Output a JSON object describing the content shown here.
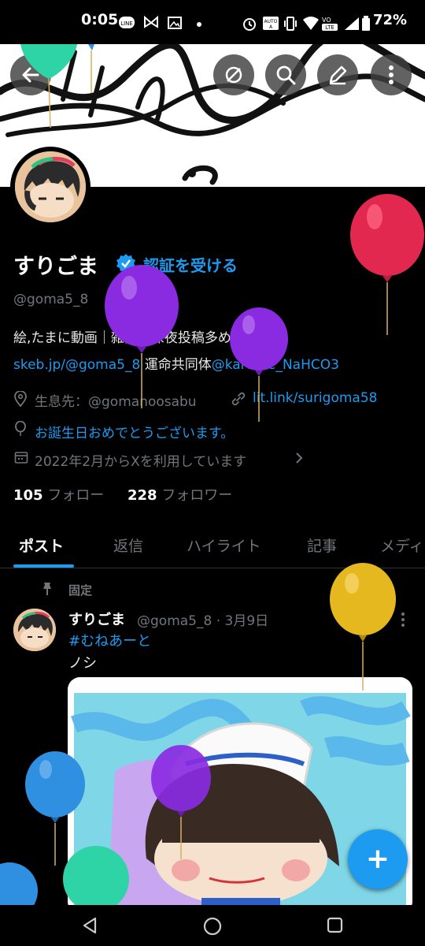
{
  "status_bar": {
    "time": "0:05",
    "battery": "72%",
    "icons": [
      "line-icon",
      "butterfly-icon",
      "gallery-icon",
      "dot-icon",
      "alarm-icon",
      "auto-brightness-icon",
      "vibrate-icon",
      "wifi-icon",
      "volte-icon",
      "battery-icon"
    ]
  },
  "header": {
    "buttons": [
      "back-icon",
      "share-icon",
      "search-icon",
      "edit-icon",
      "more-icon"
    ]
  },
  "profile": {
    "name": "すりごま",
    "verify_label": "認証を受ける",
    "handle": "@goma5_8",
    "bio_line1": "絵,たまに動画｜雑多｜深夜投稿多め skeb：",
    "bio_link1": "skeb.jp/@goma5_8",
    "bio_mid": " 運命共同体",
    "bio_link2": "@karume_NaHCO3",
    "location": "生息先：@gomanoosabu",
    "website": "lit.link/surigoma58",
    "birthday_message": "お誕生日おめでとうございます。",
    "joined": "2022年2月からXを利用しています",
    "following_count": "105",
    "following_label": "フォロー",
    "followers_count": "228",
    "followers_label": "フォロワー"
  },
  "tabs": [
    "ポスト",
    "返信",
    "ハイライト",
    "記事",
    "メディ"
  ],
  "active_tab": "ポスト",
  "pinned_tweet": {
    "pinned_label": "固定",
    "author_name": "すりごま",
    "meta": "@goma5_8 · 3月9日",
    "hashtag": "#むねあーと",
    "text": "ノシ"
  },
  "fab": {
    "symbol": "+"
  },
  "nav_bar": {
    "buttons": [
      "back-triangle-icon",
      "home-circle-icon",
      "recents-square-icon"
    ]
  },
  "colors": {
    "accent": "#1d9bf0",
    "background": "#000000",
    "balloon_teal": "#2ed3a6",
    "balloon_purple": "#8a2be2",
    "balloon_red": "#e3284f",
    "balloon_gold": "#e5b820",
    "balloon_blue": "#2f8fe0"
  }
}
